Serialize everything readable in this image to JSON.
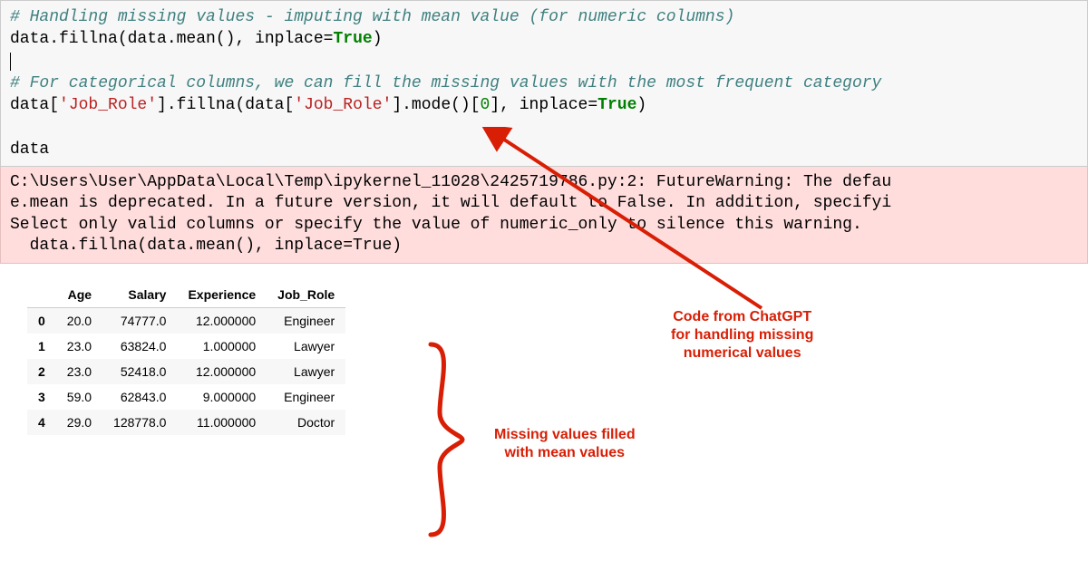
{
  "code": {
    "comment1": "# Handling missing values - imputing with mean value (for numeric columns)",
    "line2_a": "data.fillna(data.mean(), inplace=",
    "line2_b": "True",
    "line2_c": ")",
    "comment2": "# For categorical columns, we can fill the missing values with the most frequent category",
    "line5_a": "data[",
    "line5_s1": "'Job_Role'",
    "line5_b": "].fillna(data[",
    "line5_s2": "'Job_Role'",
    "line5_c": "].mode()[",
    "line5_num": "0",
    "line5_d": "], inplace=",
    "line5_bool": "True",
    "line5_e": ")",
    "line7": "data"
  },
  "warning": {
    "l1": "C:\\Users\\User\\AppData\\Local\\Temp\\ipykernel_11028\\2425719786.py:2: FutureWarning: The defau",
    "l2": "e.mean is deprecated. In a future version, it will default to False. In addition, specifyi",
    "l3": "Select only valid columns or specify the value of numeric_only to silence this warning.",
    "l4": "  data.fillna(data.mean(), inplace=True)"
  },
  "table": {
    "headers": [
      "",
      "Age",
      "Salary",
      "Experience",
      "Job_Role"
    ],
    "rows": [
      {
        "idx": "0",
        "Age": "20.0",
        "Salary": "74777.0",
        "Experience": "12.000000",
        "Job_Role": "Engineer"
      },
      {
        "idx": "1",
        "Age": "23.0",
        "Salary": "63824.0",
        "Experience": "1.000000",
        "Job_Role": "Lawyer"
      },
      {
        "idx": "2",
        "Age": "23.0",
        "Salary": "52418.0",
        "Experience": "12.000000",
        "Job_Role": "Lawyer"
      },
      {
        "idx": "3",
        "Age": "59.0",
        "Salary": "62843.0",
        "Experience": "9.000000",
        "Job_Role": "Engineer"
      },
      {
        "idx": "4",
        "Age": "29.0",
        "Salary": "128778.0",
        "Experience": "11.000000",
        "Job_Role": "Doctor"
      }
    ]
  },
  "annotations": {
    "right_label": "Code from ChatGPT\nfor handling missing\nnumerical values",
    "brace_label": "Missing values filled\nwith mean values"
  },
  "colors": {
    "annotation_red": "#d81e05"
  }
}
